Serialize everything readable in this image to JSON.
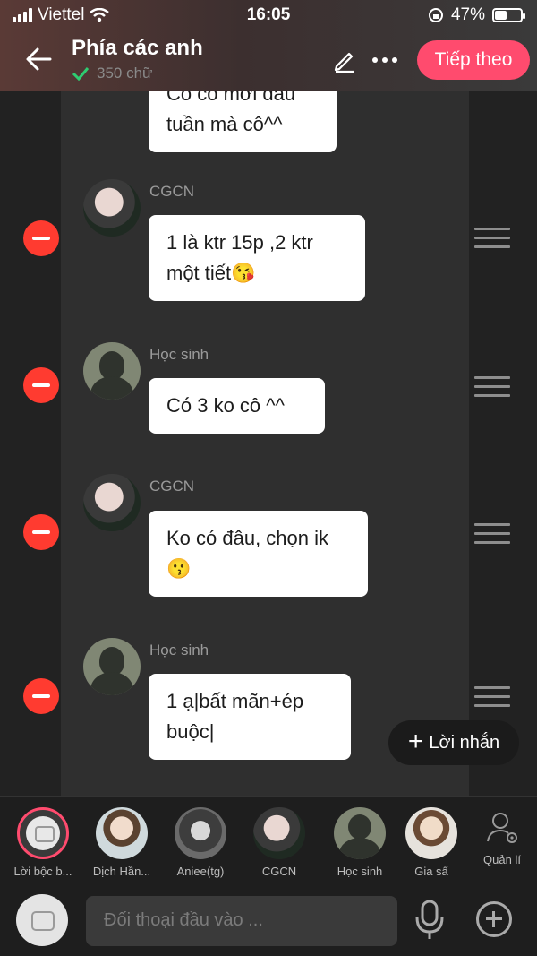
{
  "status_bar": {
    "carrier": "Viettel",
    "time": "16:05",
    "battery": "47%",
    "battery_level": 0.47
  },
  "header": {
    "title": "Phía các anh",
    "word_count": "350 chữ",
    "next_label": "Tiếp theo"
  },
  "messages": [
    {
      "sender": "",
      "lines": [
        "Cô có mới đầu",
        "tuần mà cô^^"
      ]
    },
    {
      "sender": "CGCN",
      "lines": [
        "1 là ktr 15p ,2 ktr",
        "một tiết😘"
      ]
    },
    {
      "sender": "Học sinh",
      "lines": [
        "Có 3 ko cô ^^"
      ]
    },
    {
      "sender": "CGCN",
      "lines": [
        "Ko có đâu, chọn ik",
        "😗"
      ]
    },
    {
      "sender": "Học sinh",
      "lines": [
        "1 ạ|bất mãn+ép",
        "buộc|"
      ]
    }
  ],
  "float_button": {
    "label": "Lời nhắn"
  },
  "characters": [
    {
      "name": "Lời bộc b..."
    },
    {
      "name": "Dịch Hần..."
    },
    {
      "name": "Aniee(tg)"
    },
    {
      "name": "CGCN"
    },
    {
      "name": "Học sinh"
    },
    {
      "name": "Gia sấ"
    }
  ],
  "manage_label": "Quản lí",
  "input": {
    "placeholder": "Đối thoại đầu vào ..."
  },
  "colors": {
    "accent": "#ff4b6e",
    "delete": "#ff3b30",
    "check": "#2ecc71"
  }
}
